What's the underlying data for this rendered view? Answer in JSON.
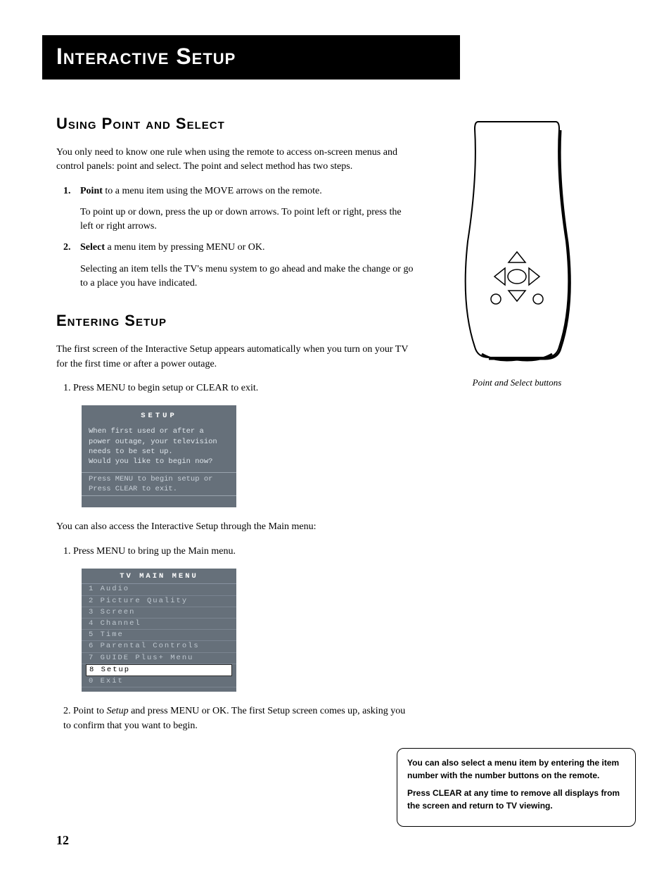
{
  "page_number": "12",
  "title": "Interactive Setup",
  "section1": {
    "heading": "Using Point and Select",
    "intro": "You only need to know one rule when using the remote to access on-screen menus and control panels: point and select. The point and select method has two steps.",
    "step1_num": "1.",
    "step1_lead": "Point",
    "step1_rest": " to a menu item using the MOVE arrows on the remote.",
    "step1_sub": "To point up or down, press the up or down arrows. To point left or right, press the left or right arrows.",
    "step2_num": "2.",
    "step2_lead": "Select",
    "step2_rest": " a menu item by pressing MENU or OK.",
    "step2_sub": "Selecting an item tells the TV's menu system to go ahead and make the change or go to a place you have indicated."
  },
  "section2": {
    "heading": "Entering Setup",
    "intro": "The first screen of the Interactive Setup appears automatically when you turn on your TV for the first time or after a power outage.",
    "step1": "1.   Press MENU to begin setup or CLEAR to exit.",
    "screen1": {
      "title": "SETUP",
      "body": "When first used or after a power outage, your television needs to be set up.\nWould you like to begin now?",
      "hint": "Press MENU to begin setup or\nPress CLEAR to exit."
    },
    "after1": "You can also access the Interactive Setup through the Main menu:",
    "step1b": "1.   Press MENU to bring up the Main menu.",
    "menu": {
      "title": "TV MAIN MENU",
      "items": [
        {
          "n": "1",
          "label": "Audio"
        },
        {
          "n": "2",
          "label": "Picture Quality"
        },
        {
          "n": "3",
          "label": "Screen"
        },
        {
          "n": "4",
          "label": "Channel"
        },
        {
          "n": "5",
          "label": "Time"
        },
        {
          "n": "6",
          "label": "Parental Controls"
        },
        {
          "n": "7",
          "label": "GUIDE Plus+ Menu"
        },
        {
          "n": "8",
          "label": "Setup",
          "selected": true
        },
        {
          "n": "0",
          "label": "Exit"
        }
      ]
    },
    "step2_pre": "2.   Point to ",
    "step2_em": "Setup",
    "step2_post": " and press MENU or OK. The first Setup screen comes up, asking you to confirm that you want to begin."
  },
  "figure_caption": "Point and Select buttons",
  "tip": {
    "p1": "You can also select a menu item by entering the item number with the number buttons on the remote.",
    "p2": "Press CLEAR at any time to remove all displays from the screen and return to TV viewing."
  }
}
